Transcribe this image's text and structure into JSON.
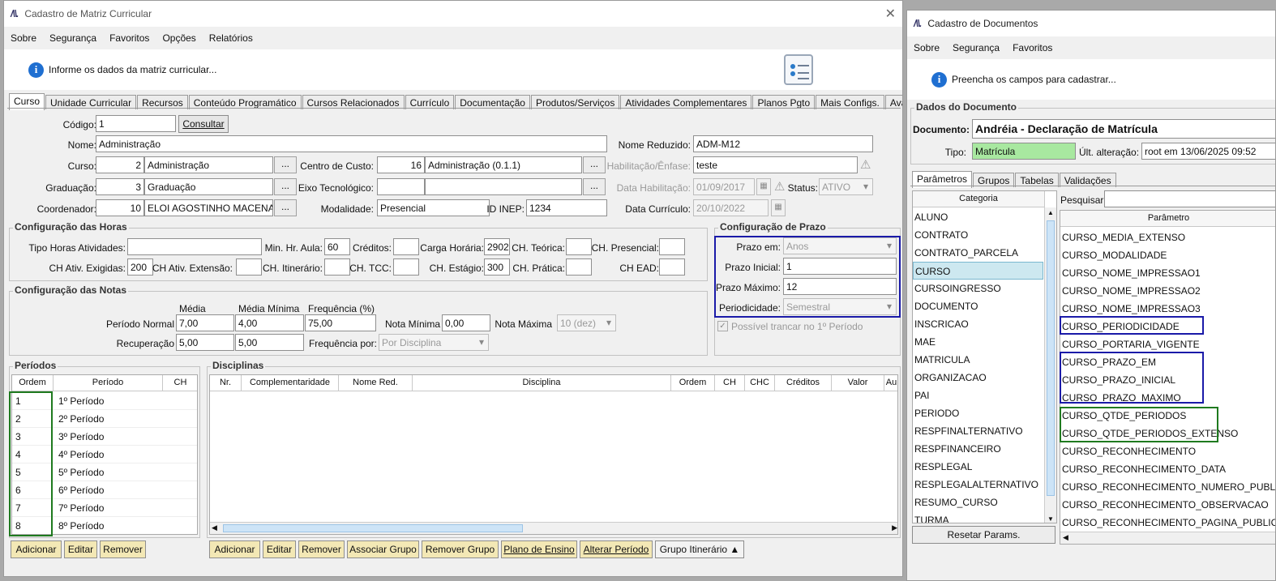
{
  "left": {
    "title": "Cadastro de Matriz Curricular",
    "menu": [
      "Sobre",
      "Segurança",
      "Favoritos",
      "Opções",
      "Relatórios"
    ],
    "info": "Informe os dados da matriz curricular...",
    "tabs": [
      "Curso",
      "Unidade Curricular",
      "Recursos",
      "Conteúdo Programático",
      "Cursos Relacionados",
      "Currículo",
      "Documentação",
      "Produtos/Serviços",
      "Atividades Complementares",
      "Planos Pgto",
      "Mais Configs.",
      "AvaliA"
    ],
    "form": {
      "codigo_label": "Código:",
      "codigo": "1",
      "consultar": "Consultar",
      "nome_label": "Nome:",
      "nome": "Administração",
      "nome_reduzido_label": "Nome Reduzido:",
      "nome_reduzido": "ADM-M12",
      "curso_label": "Curso:",
      "curso_id": "2",
      "curso": "Administração",
      "centro_label": "Centro de Custo:",
      "centro_id": "16",
      "centro": "Administração (0.1.1)",
      "habilitacao_label": "Habilitação/Ênfase:",
      "habilitacao": "teste",
      "graduacao_label": "Graduação:",
      "graduacao_id": "3",
      "graduacao": "Graduação",
      "eixo_label": "Eixo Tecnológico:",
      "data_hab_label": "Data Habilitação:",
      "data_hab": "01/09/2017",
      "status_label": "Status:",
      "status": "ATIVO",
      "coord_label": "Coordenador:",
      "coord_id": "10",
      "coord": "ELOI AGOSTINHO MACENA",
      "modalidade_label": "Modalidade:",
      "modalidade": "Presencial",
      "inep_label": "ID INEP:",
      "inep": "1234",
      "data_curr_label": "Data Currículo:",
      "data_curr": "20/10/2022",
      "dots": "..."
    },
    "horas": {
      "title": "Configuração das Horas",
      "tipo": "Tipo Horas Atividades:",
      "min_aula": "Min. Hr. Aula:",
      "min_aula_v": "60",
      "creditos": "Créditos:",
      "carga": "Carga Horária:",
      "carga_v": "2902",
      "ch_teorica": "CH. Teórica:",
      "ch_presencial": "CH. Presencial:",
      "ch_ativ": "CH Ativ. Exigidas:",
      "ch_ativ_v": "200",
      "ch_ext": "CH Ativ. Extensão:",
      "ch_itin": "CH. Itinerário:",
      "ch_tcc": "CH. TCC:",
      "ch_estagio": "CH. Estágio:",
      "ch_estagio_v": "300",
      "ch_pratica": "CH. Prática:",
      "ch_ead": "CH EAD:"
    },
    "notas": {
      "title": "Configuração das Notas",
      "media": "Média",
      "media_min": "Média Mínima",
      "freq": "Frequência (%)",
      "periodo_normal": "Período Normal",
      "pn_media": "7,00",
      "pn_min": "4,00",
      "pn_freq": "75,00",
      "nota_min": "Nota Mínima",
      "nota_min_v": "0,00",
      "nota_max": "Nota Máxima",
      "nota_max_v": "10 (dez)",
      "recuperacao": "Recuperação",
      "rec_media": "5,00",
      "rec_min": "5,00",
      "freq_por": "Frequência por:",
      "freq_por_v": "Por Disciplina"
    },
    "prazo": {
      "title": "Configuração de Prazo",
      "prazo_em": "Prazo em:",
      "prazo_em_v": "Anos",
      "prazo_ini": "Prazo Inicial:",
      "prazo_ini_v": "1",
      "prazo_max": "Prazo Máximo:",
      "prazo_max_v": "12",
      "periodicidade": "Periodicidade:",
      "periodicidade_v": "Semestral",
      "trancar": "Possível trancar no 1º Período"
    },
    "periodos": {
      "title": "Períodos",
      "cols": [
        "Ordem",
        "Período",
        "CH"
      ],
      "rows": [
        [
          "1",
          "1º Período"
        ],
        [
          "2",
          "2º Período"
        ],
        [
          "3",
          "3º Período"
        ],
        [
          "4",
          "4º Período"
        ],
        [
          "5",
          "5º Período"
        ],
        [
          "6",
          "6º Período"
        ],
        [
          "7",
          "7º Período"
        ],
        [
          "8",
          "8º Período"
        ]
      ],
      "buttons": [
        "Adicionar",
        "Editar",
        "Remover"
      ]
    },
    "disciplinas": {
      "title": "Disciplinas",
      "cols": [
        "Nr.",
        "Complementaridade",
        "Nome Red.",
        "Disciplina",
        "Ordem",
        "CH",
        "CHC",
        "Créditos",
        "Valor",
        "Au"
      ],
      "buttons": [
        "Adicionar",
        "Editar",
        "Remover",
        "Associar Grupo",
        "Remover Grupo",
        "Plano de Ensino",
        "Alterar Período",
        "Grupo Itinerário"
      ]
    },
    "green": "#1f7a1f",
    "blue": "#1a1aa8"
  },
  "right": {
    "title": "Cadastro de Documentos",
    "menu": [
      "Sobre",
      "Segurança",
      "Favoritos"
    ],
    "info": "Preencha os campos para cadastrar...",
    "group": "Dados do Documento",
    "doc_label": "Documento:",
    "doc": "Andréia - Declaração de Matrícula",
    "tipo_label": "Tipo:",
    "tipo": "Matrícula",
    "ult_label": "Últ. alteração:",
    "ult": "root em 13/06/2025 09:52",
    "tabs": [
      "Parâmetros",
      "Grupos",
      "Tabelas",
      "Validações"
    ],
    "categoria_header": "Categoria",
    "categorias": [
      "ALUNO",
      "CONTRATO",
      "CONTRATO_PARCELA",
      "CURSO",
      "CURSOINGRESSO",
      "DOCUMENTO",
      "INSCRICAO",
      "MAE",
      "MATRICULA",
      "ORGANIZACAO",
      "PAI",
      "PERIODO",
      "RESPFINALTERNATIVO",
      "RESPFINANCEIRO",
      "RESPLEGAL",
      "RESPLEGALALTERNATIVO",
      "RESUMO_CURSO",
      "TURMA"
    ],
    "selected": "CURSO",
    "pesquisar": "Pesquisar:",
    "param_header": "Parâmetro",
    "parametros": [
      "CURSO_MEDIA_EXTENSO",
      "CURSO_MODALIDADE",
      "CURSO_NOME_IMPRESSAO1",
      "CURSO_NOME_IMPRESSAO2",
      "CURSO_NOME_IMPRESSAO3",
      "CURSO_PERIODICIDADE",
      "CURSO_PORTARIA_VIGENTE",
      "CURSO_PRAZO_EM",
      "CURSO_PRAZO_INICIAL",
      "CURSO_PRAZO_MAXIMO",
      "CURSO_QTDE_PERIODOS",
      "CURSO_QTDE_PERIODOS_EXTENSO",
      "CURSO_RECONHECIMENTO",
      "CURSO_RECONHECIMENTO_DATA",
      "CURSO_RECONHECIMENTO_NUMERO_PUBLIC...",
      "CURSO_RECONHECIMENTO_OBSERVACAO",
      "CURSO_RECONHECIMENTO_PAGINA_PUBLIC..."
    ],
    "resetar": "Resetar Params."
  }
}
